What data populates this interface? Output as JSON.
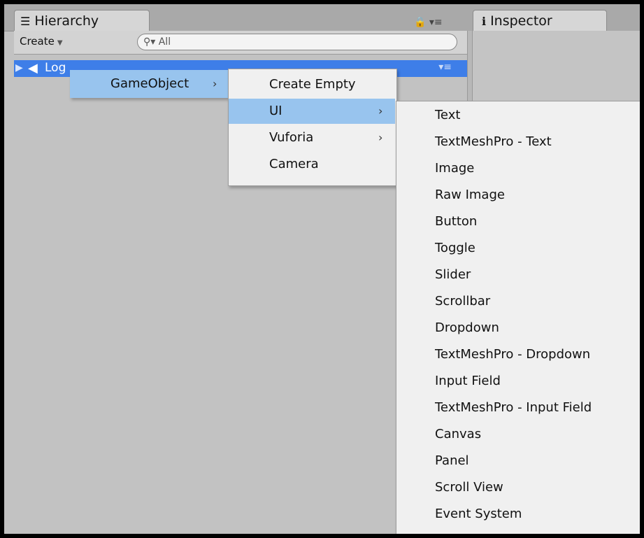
{
  "tabs": {
    "hierarchy": {
      "label": "Hierarchy",
      "icon": "list-icon"
    },
    "inspector": {
      "label": "Inspector",
      "icon": "info-icon"
    }
  },
  "toolbar": {
    "create_label": "Create",
    "search_placeholder": "All"
  },
  "hierarchy": {
    "selected_item": "Log"
  },
  "menu_level1": {
    "label": "GameObject"
  },
  "menu_level2": {
    "items": [
      "Create Empty",
      "UI",
      "Vuforia",
      "Camera"
    ]
  },
  "menu_level3": {
    "items": [
      "Text",
      "TextMeshPro - Text",
      "Image",
      "Raw Image",
      "Button",
      "Toggle",
      "Slider",
      "Scrollbar",
      "Dropdown",
      "TextMeshPro - Dropdown",
      "Input Field",
      "TextMeshPro - Input Field",
      "Canvas",
      "Panel",
      "Scroll View",
      "Event System"
    ]
  },
  "colors": {
    "selection": "#3e7ee8",
    "menu_highlight": "#98c4ee",
    "menu_bg": "#f0f0f0",
    "panel_bg": "#c2c2c2"
  }
}
